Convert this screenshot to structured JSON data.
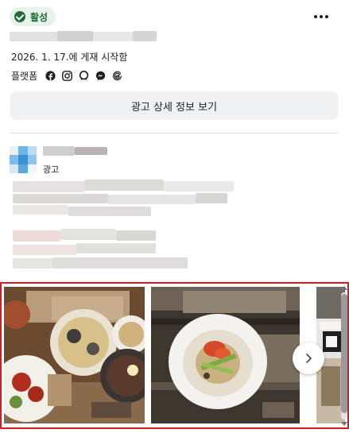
{
  "status": {
    "label": "활성",
    "color": "#1e6b35",
    "background": "#e7f3ea"
  },
  "ad": {
    "start_text": "2026. 1. 17.에 게재 시작함",
    "platform_label": "플랫폼",
    "platforms": [
      "facebook-icon",
      "instagram-icon",
      "audience-network-icon",
      "messenger-icon",
      "threads-icon"
    ],
    "details_button": "광고 상세 정보 보기",
    "sponsored_label": "광고"
  },
  "carousel": {
    "next_icon": "chevron-right-icon",
    "cards": [
      {
        "name": "card-noodle-spread"
      },
      {
        "name": "card-bibim-noodle-bowl"
      },
      {
        "name": "card-storefront"
      }
    ]
  },
  "colors": {
    "accent": "#e0181b",
    "button_bg": "#f0f1f2",
    "divider": "#dadde1"
  }
}
